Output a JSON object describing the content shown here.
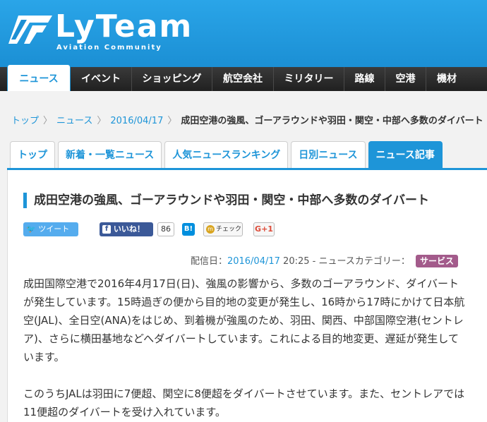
{
  "site": {
    "logo_text": "LyTeam",
    "logo_sub": "Aviation Community"
  },
  "nav": {
    "items": [
      {
        "label": "ニュース",
        "active": true
      },
      {
        "label": "イベント"
      },
      {
        "label": "ショッピング"
      },
      {
        "label": "航空会社"
      },
      {
        "label": "ミリタリー"
      },
      {
        "label": "路線"
      },
      {
        "label": "空港"
      },
      {
        "label": "機材"
      }
    ]
  },
  "breadcrumb": {
    "items": [
      "トップ",
      "ニュース",
      "2016/04/17"
    ],
    "current": "成田空港の強風、ゴーアラウンドや羽田・関空・中部へ多数のダイバート"
  },
  "tabs": [
    {
      "label": "トップ"
    },
    {
      "label": "新着・一覧ニュース"
    },
    {
      "label": "人気ニュースランキング"
    },
    {
      "label": "日別ニュース"
    },
    {
      "label": "ニュース記事",
      "active": true
    }
  ],
  "article": {
    "title": "成田空港の強風、ゴーアラウンドや羽田・関空・中部へ多数のダイバート",
    "share": {
      "tweet": "ツイート",
      "like": "いいね！",
      "like_count": "86",
      "hatena": "B!",
      "check": "チェック",
      "gplus": "G+1"
    },
    "meta": {
      "prefix": "配信日：",
      "date": "2016/04/17",
      "time": "20:25",
      "category_prefix": "- ニュースカテゴリー：",
      "category": "サービス"
    },
    "paragraphs": [
      "成田国際空港で2016年4月17日(日)、強風の影響から、多数のゴーアラウンド、ダイバートが発生しています。15時過ぎの便から目的地の変更が発生し、16時から17時にかけて日本航空(JAL)、全日空(ANA)をはじめ、到着機が強風のため、羽田、関西、中部国際空港(セントレア)、さらに横田基地などへダイバートしています。これによる目的地変更、遅延が発生しています。",
      "このうちJALは羽田に7便超、関空に8便超をダイバートさせています。また、セントレアでは11便超のダイバートを受け入れています。"
    ]
  },
  "colors": {
    "brand_blue": "#1e95d8",
    "nav_dark": "#202020",
    "category_badge": "#a35b8b"
  }
}
